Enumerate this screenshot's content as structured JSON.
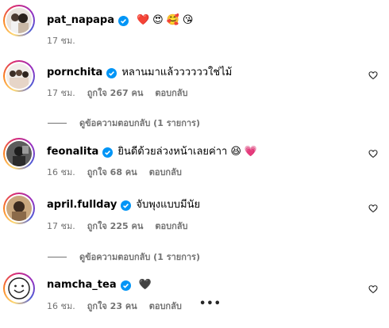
{
  "post": {
    "username": "pat_napapa",
    "emojis": [
      "❤️",
      "😍",
      "🥰",
      "😘"
    ],
    "time": "17 ชม."
  },
  "comments": [
    {
      "username": "pornchita",
      "text": "หลานมาแล้ววววววใช่ไม้",
      "emojis": [],
      "time": "17 ชม.",
      "likes": "ถูกใจ 267 คน",
      "reply": "ตอบกลับ",
      "view_replies": "ดูข้อความตอบกลับ (1 รายการ)"
    },
    {
      "username": "feonalita",
      "text": "ยินดีด้วยล่วงหน้าเลยค่าา",
      "emojis": [
        "😆",
        "💗"
      ],
      "time": "16 ชม.",
      "likes": "ถูกใจ 68 คน",
      "reply": "ตอบกลับ"
    },
    {
      "username": "april.fullday",
      "text": "จับพุงแบบมีนัย",
      "emojis": [],
      "time": "17 ชม.",
      "likes": "ถูกใจ 225 คน",
      "reply": "ตอบกลับ",
      "view_replies": "ดูข้อความตอบกลับ (1 รายการ)"
    },
    {
      "username": "namcha_tea",
      "text": "",
      "emojis": [
        "🖤"
      ],
      "time": "16 ชม.",
      "likes": "ถูกใจ 23 คน",
      "reply": "ตอบกลับ",
      "more": "•••"
    }
  ],
  "colors": {
    "verified": "#0095f6",
    "meta": "#737373",
    "text": "#000000"
  }
}
